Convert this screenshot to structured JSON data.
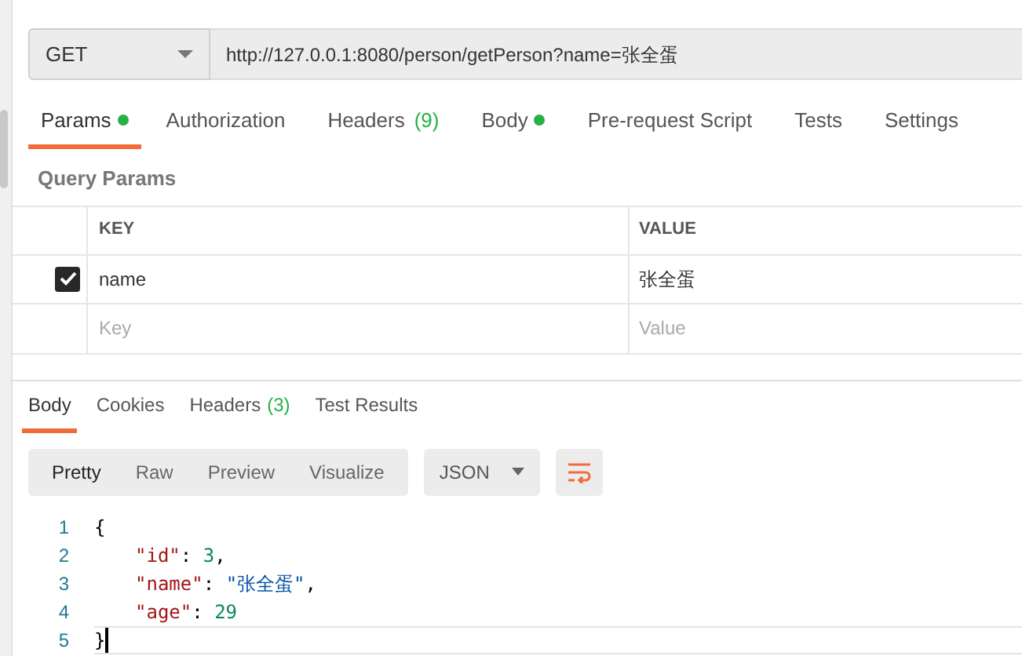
{
  "request": {
    "method": "GET",
    "url": "http://127.0.0.1:8080/person/getPerson?name=张全蛋"
  },
  "request_tabs": [
    {
      "label": "Params",
      "selected": true,
      "dot": true
    },
    {
      "label": "Authorization",
      "selected": false,
      "dot": false
    },
    {
      "label": "Headers",
      "count": "(9)",
      "selected": false,
      "dot": false
    },
    {
      "label": "Body",
      "selected": false,
      "dot": true
    },
    {
      "label": "Pre-request Script",
      "selected": false,
      "dot": false
    },
    {
      "label": "Tests",
      "selected": false,
      "dot": false
    },
    {
      "label": "Settings",
      "selected": false,
      "dot": false
    }
  ],
  "query_params": {
    "title": "Query Params",
    "columns": [
      "KEY",
      "VALUE"
    ],
    "rows": [
      {
        "checked": true,
        "key": "name",
        "value": "张全蛋"
      }
    ],
    "new_row": {
      "key_placeholder": "Key",
      "value_placeholder": "Value"
    }
  },
  "response_tabs": [
    {
      "label": "Body",
      "selected": true
    },
    {
      "label": "Cookies",
      "selected": false
    },
    {
      "label": "Headers",
      "count": "(3)",
      "selected": false
    },
    {
      "label": "Test Results",
      "selected": false
    }
  ],
  "view_modes": [
    {
      "label": "Pretty",
      "selected": true
    },
    {
      "label": "Raw",
      "selected": false
    },
    {
      "label": "Preview",
      "selected": false
    },
    {
      "label": "Visualize",
      "selected": false
    }
  ],
  "format": "JSON",
  "code": [
    {
      "number": "1",
      "tokens": [
        {
          "kind": "punct",
          "text": "{"
        }
      ],
      "children": [
        {
          "number": "2",
          "tokens": [
            {
              "kind": "key",
              "text": "\"id\""
            },
            {
              "kind": "punct",
              "text": ": "
            },
            {
              "kind": "number",
              "text": "3"
            },
            {
              "kind": "punct",
              "text": ","
            }
          ]
        },
        {
          "number": "3",
          "tokens": [
            {
              "kind": "key",
              "text": "\"name\""
            },
            {
              "kind": "punct",
              "text": ": "
            },
            {
              "kind": "string",
              "text": "\"张全蛋\""
            },
            {
              "kind": "punct",
              "text": ","
            }
          ]
        },
        {
          "number": "4",
          "tokens": [
            {
              "kind": "key",
              "text": "\"age\""
            },
            {
              "kind": "punct",
              "text": ": "
            },
            {
              "kind": "number",
              "text": "29"
            }
          ]
        }
      ]
    },
    {
      "number": "5",
      "tokens": [
        {
          "kind": "punct",
          "text": "}"
        }
      ],
      "cursor": true
    }
  ]
}
